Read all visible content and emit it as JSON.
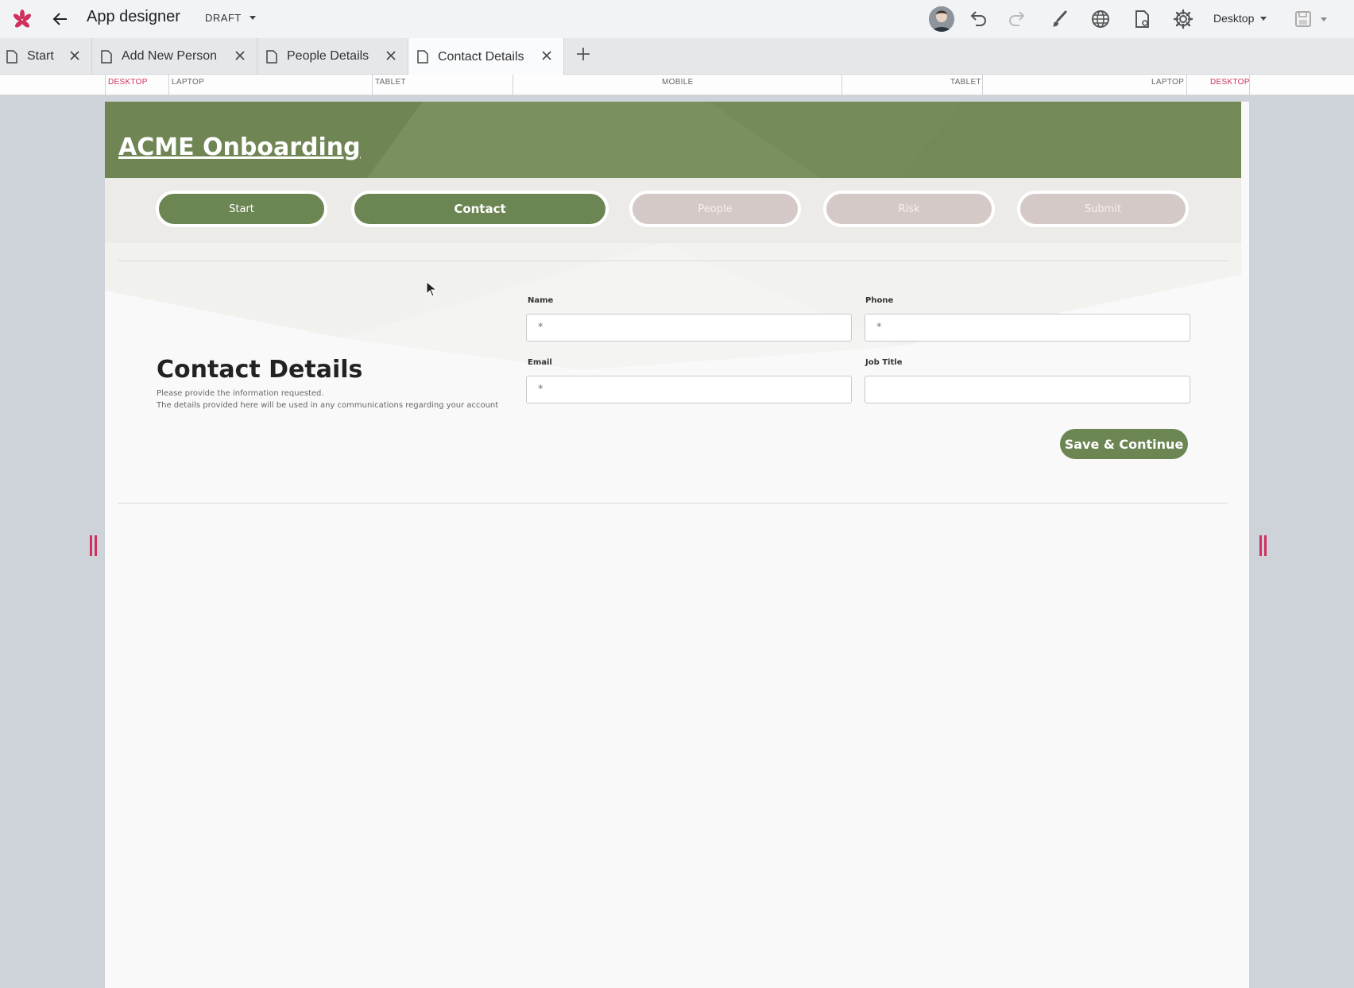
{
  "topbar": {
    "app_title": "App designer",
    "status": "DRAFT",
    "device": "Desktop",
    "icons": [
      "logo-icon",
      "back-arrow-icon",
      "avatar",
      "undo-icon",
      "redo-icon",
      "paintbrush-icon",
      "globe-icon",
      "page-settings-icon",
      "gear-icon",
      "save-icon"
    ]
  },
  "tabs": [
    {
      "label": "Start"
    },
    {
      "label": "Add New Person"
    },
    {
      "label": "People Details"
    },
    {
      "label": "Contact Details",
      "active": true
    }
  ],
  "ruler": {
    "labels": [
      "DESKTOP",
      "LAPTOP",
      "TABLET",
      "MOBILE",
      "TABLET",
      "LAPTOP",
      "DESKTOP"
    ]
  },
  "page": {
    "hero_title": "ACME Onboarding",
    "steps": [
      {
        "label": "Start",
        "state": "done"
      },
      {
        "label": "Contact",
        "state": "current"
      },
      {
        "label": "People",
        "state": "todo"
      },
      {
        "label": "Risk",
        "state": "todo"
      },
      {
        "label": "Submit",
        "state": "todo"
      }
    ],
    "section_title": "Contact Details",
    "section_sub1": "Please provide the information requested.",
    "section_sub2": "The details provided here will be used in any communications regarding your account",
    "fields": {
      "name": {
        "label": "Name",
        "placeholder": "*"
      },
      "phone": {
        "label": "Phone",
        "placeholder": "*"
      },
      "email": {
        "label": "Email",
        "placeholder": "*"
      },
      "job_title": {
        "label": "Job Title",
        "placeholder": ""
      }
    },
    "save_label": "Save & Continue"
  },
  "colors": {
    "brand_green": "#6b8553",
    "accent_red": "#d0305c",
    "step_todo": "#d5c9c7"
  }
}
